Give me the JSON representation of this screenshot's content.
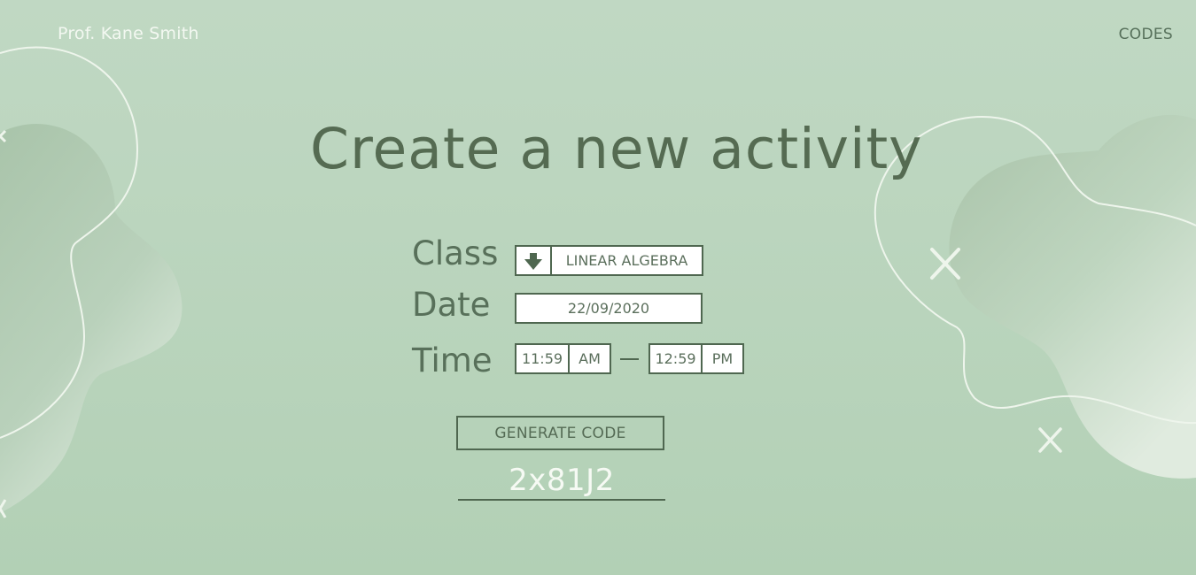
{
  "header": {
    "user_name": "Prof. Kane Smith",
    "nav_codes": "CODES"
  },
  "page": {
    "title": "Create a new activity"
  },
  "form": {
    "class_label": "Class",
    "class_value": "LINEAR ALGEBRA",
    "date_label": "Date",
    "date_value": "22/09/2020",
    "time_label": "Time",
    "start_time": "11:59",
    "start_period": "AM",
    "end_time": "12:59",
    "end_period": "PM"
  },
  "actions": {
    "generate_label": "GENERATE CODE"
  },
  "result": {
    "code": "2x81J2"
  },
  "icons": {
    "class_dropdown": "arrow-down-icon",
    "decor": "x-mark-icon"
  },
  "colors": {
    "background": "#bdd6c0",
    "primary_text": "#556b52",
    "border": "#4f6750",
    "light_text": "#f3f8f1"
  }
}
